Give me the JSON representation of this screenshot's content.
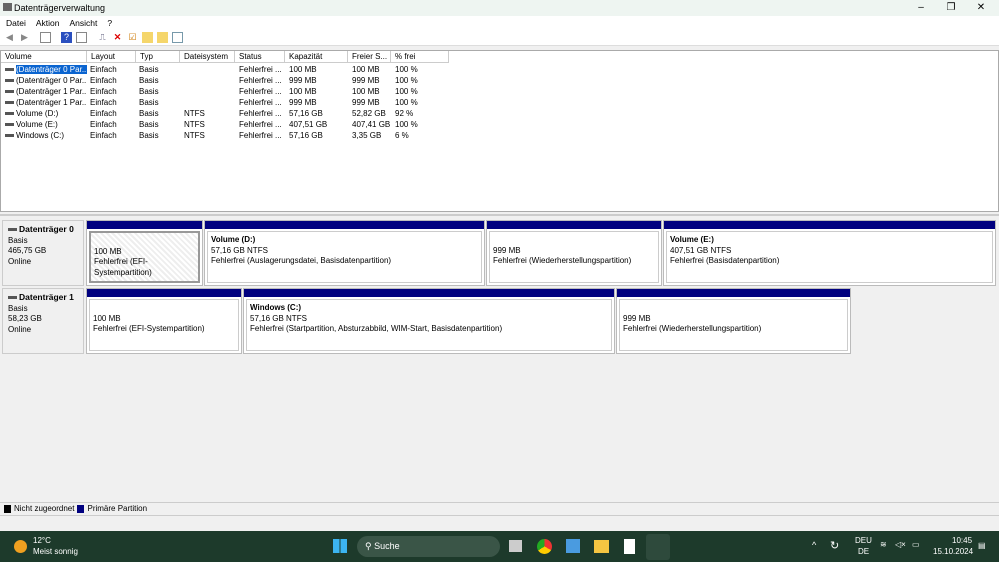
{
  "window": {
    "title": "Datenträgerverwaltung",
    "minimize": "–",
    "maximize": "❐",
    "close": "✕"
  },
  "menu": [
    "Datei",
    "Aktion",
    "Ansicht",
    "?"
  ],
  "table": {
    "headers": [
      "Volume",
      "Layout",
      "Typ",
      "Dateisystem",
      "Status",
      "Kapazität",
      "Freier S...",
      "% frei"
    ],
    "rows": [
      [
        "(Datenträger 0 Par...",
        "Einfach",
        "Basis",
        "",
        "Fehlerfrei ...",
        "100 MB",
        "100 MB",
        "100 %"
      ],
      [
        "(Datenträger 0 Par...",
        "Einfach",
        "Basis",
        "",
        "Fehlerfrei ...",
        "999 MB",
        "999 MB",
        "100 %"
      ],
      [
        "(Datenträger 1 Par...",
        "Einfach",
        "Basis",
        "",
        "Fehlerfrei ...",
        "100 MB",
        "100 MB",
        "100 %"
      ],
      [
        "(Datenträger 1 Par...",
        "Einfach",
        "Basis",
        "",
        "Fehlerfrei ...",
        "999 MB",
        "999 MB",
        "100 %"
      ],
      [
        "Volume (D:)",
        "Einfach",
        "Basis",
        "NTFS",
        "Fehlerfrei ...",
        "57,16 GB",
        "52,82 GB",
        "92 %"
      ],
      [
        "Volume (E:)",
        "Einfach",
        "Basis",
        "NTFS",
        "Fehlerfrei ...",
        "407,51 GB",
        "407,41 GB",
        "100 %"
      ],
      [
        "Windows (C:)",
        "Einfach",
        "Basis",
        "NTFS",
        "Fehlerfrei ...",
        "57,16 GB",
        "3,35 GB",
        "6 %"
      ]
    ]
  },
  "disks": [
    {
      "name": "Datenträger 0",
      "type": "Basis",
      "size": "465,75 GB",
      "state": "Online",
      "partitions": [
        {
          "title": "",
          "line1": "100 MB",
          "line2": "Fehlerfrei (EFI-Systempartition)"
        },
        {
          "title": "Volume  (D:)",
          "line1": "57,16 GB NTFS",
          "line2": "Fehlerfrei (Auslagerungsdatei, Basisdatenpartition)"
        },
        {
          "title": "",
          "line1": "999 MB",
          "line2": "Fehlerfrei (Wiederherstellungspartition)"
        },
        {
          "title": "Volume  (E:)",
          "line1": "407,51 GB NTFS",
          "line2": "Fehlerfrei (Basisdatenpartition)"
        }
      ]
    },
    {
      "name": "Datenträger 1",
      "type": "Basis",
      "size": "58,23 GB",
      "state": "Online",
      "partitions": [
        {
          "title": "",
          "line1": "100 MB",
          "line2": "Fehlerfrei (EFI-Systempartition)"
        },
        {
          "title": "Windows  (C:)",
          "line1": "57,16 GB NTFS",
          "line2": "Fehlerfrei (Startpartition, Absturzabbild, WIM-Start, Basisdatenpartition)"
        },
        {
          "title": "",
          "line1": "999 MB",
          "line2": "Fehlerfrei (Wiederherstellungspartition)"
        }
      ]
    }
  ],
  "legend": {
    "unallocated": "Nicht zugeordnet",
    "primary": "Primäre Partition",
    "unallocated_color": "#000000",
    "primary_color": "#00007f"
  },
  "taskbar": {
    "temp": "12°C",
    "weather": "Meist sonnig",
    "search": "Suche",
    "lang1": "DEU",
    "lang2": "DE",
    "time": "10:45",
    "date": "15.10.2024"
  }
}
